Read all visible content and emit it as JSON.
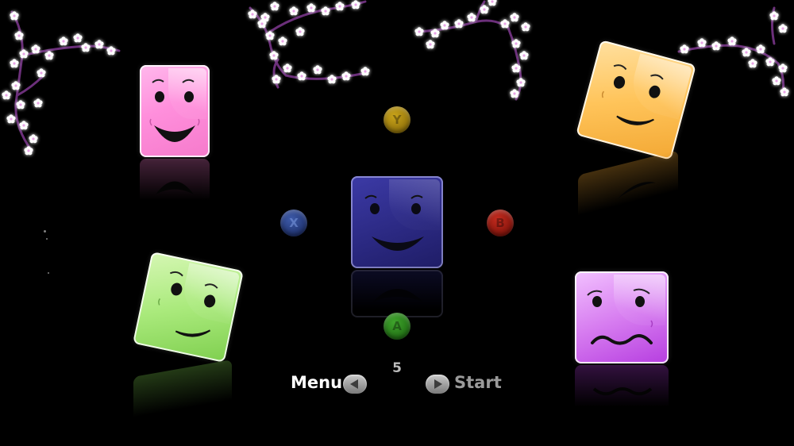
{
  "nav": {
    "menu_label": "Menu",
    "start_label": "Start",
    "level_number": "5",
    "menu_color": "#ffffff",
    "start_color": "#9a9a9a"
  },
  "pad_buttons": {
    "y": "Y",
    "x": "X",
    "b": "B",
    "a": "A"
  },
  "faces": {
    "pink": {
      "color": "#ff8fdc",
      "expression": "happy"
    },
    "orange": {
      "color": "#ffc45a",
      "expression": "smile"
    },
    "green": {
      "color": "#aaea7c",
      "expression": "smirk"
    },
    "purple": {
      "color": "#d77df0",
      "expression": "worried"
    },
    "blue": {
      "color": "#2a2880",
      "expression": "happy"
    }
  },
  "decor": {
    "blossom_color": "#ffe6ff",
    "branch_color": "#7a3a8a"
  }
}
